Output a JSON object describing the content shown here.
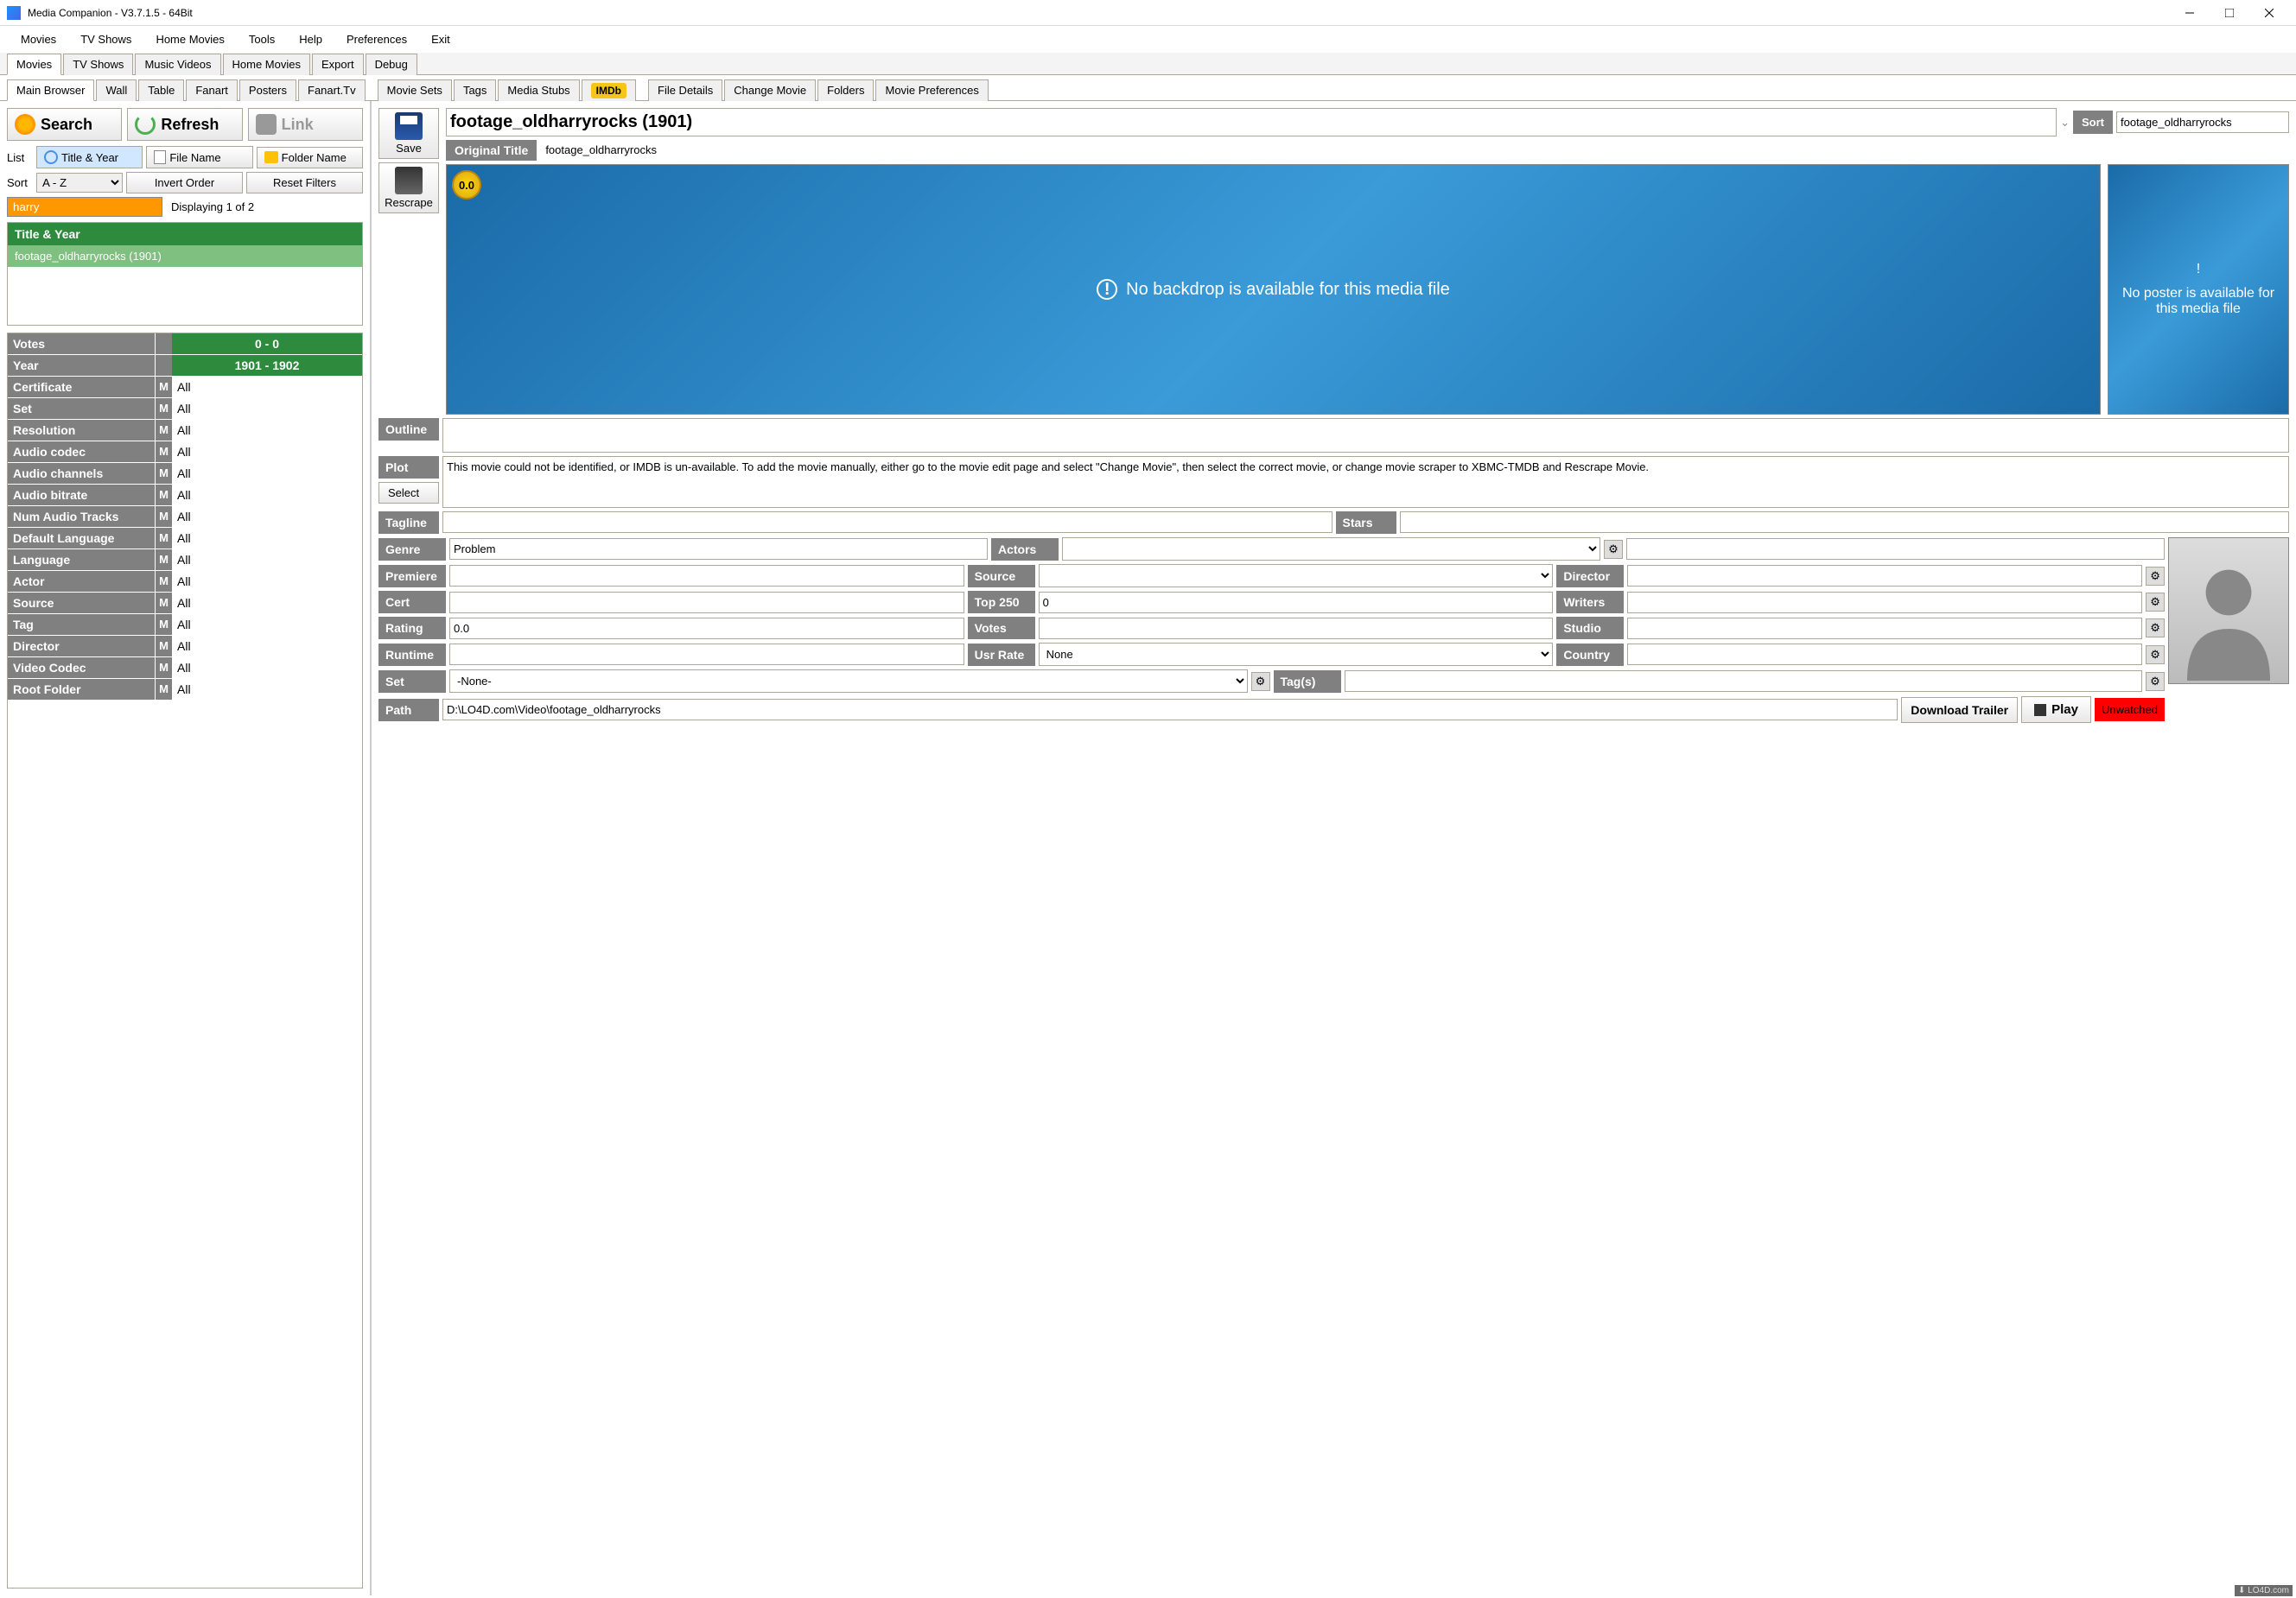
{
  "window": {
    "title": "Media Companion - V3.7.1.5 - 64Bit"
  },
  "menubar": [
    "Movies",
    "TV Shows",
    "Home Movies",
    "Tools",
    "Help",
    "Preferences",
    "Exit"
  ],
  "mainTabs": [
    "Movies",
    "TV Shows",
    "Music Videos",
    "Home Movies",
    "Export",
    "Debug"
  ],
  "subTabs": [
    "Main Browser",
    "Wall",
    "Table",
    "Fanart",
    "Posters",
    "Fanart.Tv",
    "Movie Sets",
    "Tags",
    "Media Stubs",
    "IMDb",
    "File Details",
    "Change Movie",
    "Folders",
    "Movie Preferences"
  ],
  "leftPanel": {
    "searchBtn": "Search",
    "refreshBtn": "Refresh",
    "linkBtn": "Link",
    "listLabel": "List",
    "titleYearBtn": "Title & Year",
    "fileNameBtn": "File Name",
    "folderNameBtn": "Folder Name",
    "sortLabel": "Sort",
    "sortValue": "A - Z",
    "invertBtn": "Invert Order",
    "resetBtn": "Reset Filters",
    "searchValue": "harry",
    "displaying": "Displaying 1 of 2",
    "listHeader": "Title & Year",
    "listItem": "footage_oldharryrocks (1901)",
    "filters": [
      {
        "label": "Votes",
        "m": "",
        "val": "0 - 0",
        "green": true
      },
      {
        "label": "Year",
        "m": "",
        "val": "1901 - 1902",
        "green": true
      },
      {
        "label": "Certificate",
        "m": "M",
        "val": "All"
      },
      {
        "label": "Set",
        "m": "M",
        "val": "All"
      },
      {
        "label": "Resolution",
        "m": "M",
        "val": "All"
      },
      {
        "label": "Audio codec",
        "m": "M",
        "val": "All"
      },
      {
        "label": "Audio channels",
        "m": "M",
        "val": "All"
      },
      {
        "label": "Audio bitrate",
        "m": "M",
        "val": "All"
      },
      {
        "label": "Num Audio Tracks",
        "m": "M",
        "val": "All"
      },
      {
        "label": "Default Language",
        "m": "M",
        "val": "All"
      },
      {
        "label": "Language",
        "m": "M",
        "val": "All"
      },
      {
        "label": "Actor",
        "m": "M",
        "val": "All"
      },
      {
        "label": "Source",
        "m": "M",
        "val": "All"
      },
      {
        "label": "Tag",
        "m": "M",
        "val": "All"
      },
      {
        "label": "Director",
        "m": "M",
        "val": "All"
      },
      {
        "label": "Video Codec",
        "m": "M",
        "val": "All"
      },
      {
        "label": "Root Folder",
        "m": "M",
        "val": "All"
      }
    ]
  },
  "rightPanel": {
    "saveBtn": "Save",
    "rescrapeBtn": "Rescrape",
    "title": "footage_oldharryrocks (1901)",
    "sortLabel": "Sort",
    "sortValue": "footage_oldharryrocks",
    "origTitleLabel": "Original Title",
    "origTitle": "footage_oldharryrocks",
    "ratingBadge": "0.0",
    "backdropMsg": "No backdrop is available for this media file",
    "posterMsg": "No poster is available for this media file",
    "outlineLabel": "Outline",
    "outline": "",
    "plotLabel": "Plot",
    "selectBtn": "Select",
    "plot": "This movie could not be identified, or IMDB is un-available. To add the movie manually, either go to the movie edit page and select \"Change Movie\", then select the correct movie, or change movie scraper to XBMC-TMDB and Rescrape Movie.",
    "taglineLabel": "Tagline",
    "tagline": "",
    "starsLabel": "Stars",
    "stars": "",
    "genreLabel": "Genre",
    "genre": "Problem",
    "actorsLabel": "Actors",
    "actors": "",
    "premiereLabel": "Premiere",
    "premiere": "",
    "sourceLabel": "Source",
    "source": "",
    "directorLabel": "Director",
    "director": "",
    "certLabel": "Cert",
    "cert": "",
    "top250Label": "Top 250",
    "top250": "0",
    "writersLabel": "Writers",
    "writers": "",
    "ratingLabel": "Rating",
    "rating": "0.0",
    "votesLabel": "Votes",
    "votes": "",
    "studioLabel": "Studio",
    "studio": "",
    "runtimeLabel": "Runtime",
    "runtime": "",
    "usrRateLabel": "Usr Rate",
    "usrRate": "None",
    "countryLabel": "Country",
    "country": "",
    "setLabel": "Set",
    "set": "-None-",
    "tagsLabel": "Tag(s)",
    "tags": "",
    "pathLabel": "Path",
    "path": "D:\\LO4D.com\\Video\\footage_oldharryrocks",
    "downloadTrailerBtn": "Download Trailer",
    "playBtn": "Play",
    "unwatchedBtn": "Unwatched"
  },
  "watermark": "⬇ LO4D.com"
}
